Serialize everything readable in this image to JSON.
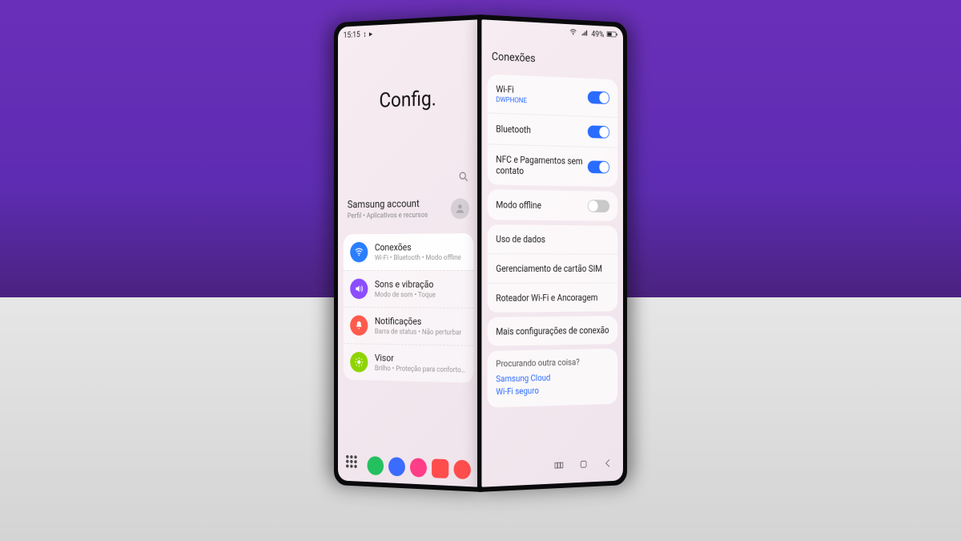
{
  "status": {
    "time": "15:15",
    "battery_text": "49%"
  },
  "left": {
    "title": "Config.",
    "account": {
      "title": "Samsung account",
      "subtitle": "Perfil • Aplicativos e recursos"
    },
    "categories": [
      {
        "title": "Conexões",
        "subtitle": "Wi-Fi • Bluetooth • Modo offline",
        "color": "#2a7eff",
        "icon": "wifi",
        "active": true
      },
      {
        "title": "Sons e vibração",
        "subtitle": "Modo de som • Toque",
        "color": "#8b4dff",
        "icon": "sound",
        "active": false
      },
      {
        "title": "Notificações",
        "subtitle": "Barra de status • Não perturbar",
        "color": "#ff5a4d",
        "icon": "bell",
        "active": false
      },
      {
        "title": "Visor",
        "subtitle": "Brilho • Proteção para conforto ocular",
        "color": "#8fd400",
        "icon": "sun",
        "active": false
      }
    ]
  },
  "right": {
    "heading": "Conexões",
    "group1": [
      {
        "title": "Wi-Fi",
        "subtitle": "DWPHONE",
        "toggle": "on"
      },
      {
        "title": "Bluetooth",
        "toggle": "on"
      },
      {
        "title": "NFC e Pagamentos sem contato",
        "toggle": "on"
      }
    ],
    "group2": [
      {
        "title": "Modo offline",
        "toggle": "off"
      }
    ],
    "group3": [
      {
        "title": "Uso de dados"
      },
      {
        "title": "Gerenciamento de cartão SIM"
      },
      {
        "title": "Roteador Wi-Fi e Ancoragem"
      }
    ],
    "group4": [
      {
        "title": "Mais configurações de conexão"
      }
    ],
    "search": {
      "question": "Procurando outra coisa?",
      "links": [
        "Samsung Cloud",
        "Wi-Fi seguro"
      ]
    }
  }
}
